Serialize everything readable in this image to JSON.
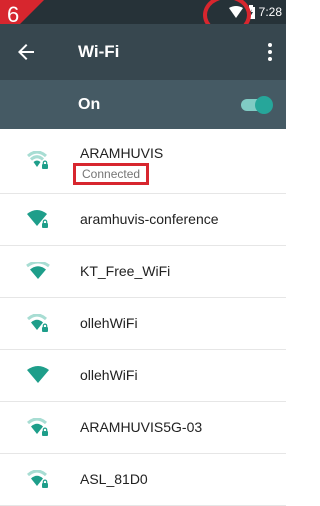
{
  "annotation": {
    "step_number": "6"
  },
  "status_bar": {
    "time": "7:28"
  },
  "toolbar": {
    "title": "Wi-Fi"
  },
  "master_switch": {
    "label": "On",
    "on": true
  },
  "networks": [
    {
      "ssid": "ARAMHUVIS",
      "status": "Connected",
      "secured": true,
      "icon": "wifi-signal-lock-icon"
    },
    {
      "ssid": "aramhuvis-conference",
      "secured": true,
      "icon": "wifi-signal-lock-icon"
    },
    {
      "ssid": "KT_Free_WiFi",
      "secured": false,
      "icon": "wifi-signal-icon"
    },
    {
      "ssid": "ollehWiFi",
      "secured": true,
      "icon": "wifi-signal-lock-icon"
    },
    {
      "ssid": "ollehWiFi",
      "secured": false,
      "icon": "wifi-signal-icon"
    },
    {
      "ssid": "ARAMHUVIS5G-03",
      "secured": true,
      "icon": "wifi-signal-lock-icon"
    },
    {
      "ssid": "ASL_81D0",
      "secured": true,
      "icon": "wifi-signal-lock-icon"
    }
  ],
  "colors": {
    "accent": "#26a69a",
    "wifi_icon": "#1e9e8a",
    "annotation_red": "#d7262e",
    "toolbar": "#37474f",
    "status_bar": "#263238"
  }
}
